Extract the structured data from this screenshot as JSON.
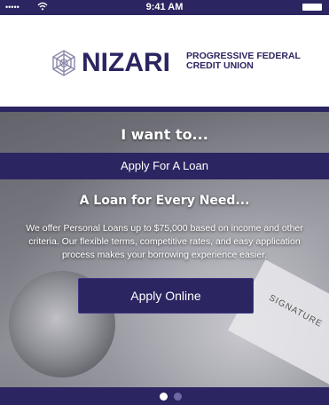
{
  "status_bar": {
    "signal": "•••••",
    "wifi": "wifi-icon",
    "time": "9:41 AM",
    "battery": "battery-icon"
  },
  "logo": {
    "name": "NIZARI",
    "line1": "PROGRESSIVE FEDERAL",
    "line2": "CREDIT UNION",
    "emblem": "emblem-icon"
  },
  "hero": {
    "prompt": "I want to...",
    "selected_option": "Apply For A Loan",
    "headline": "A Loan for Every Need...",
    "description": "We offer Personal Loans up to $75,000 based on income and other criteria. Our flexible terms, competitive rates, and easy application process makes your borrowing experience easier.",
    "button_label": "Apply Online",
    "signature_text": "SIGNATURE"
  },
  "pager": {
    "active_index": 0,
    "count": 2
  },
  "colors": {
    "brand": "#2b2561",
    "white": "#ffffff"
  }
}
